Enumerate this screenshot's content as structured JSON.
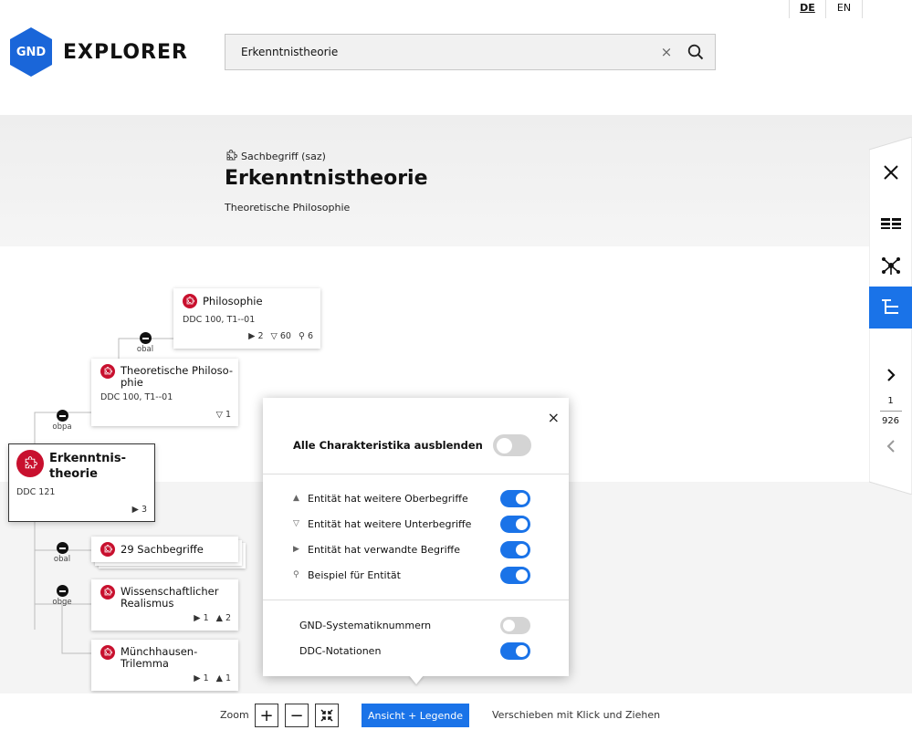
{
  "header": {
    "languages": [
      {
        "label": "DE",
        "active": true
      },
      {
        "label": "EN",
        "active": false
      }
    ],
    "logo_badge": "GND",
    "logo_text": "EXPLORER",
    "search": {
      "value": "Erkenntnistheorie",
      "clear": "×"
    }
  },
  "entity": {
    "type_label": "Sachbegriff (saz)",
    "title": "Erkenntnistheorie",
    "subtitle": "Theoretische Philosophie"
  },
  "rail": {
    "page_current": "1",
    "page_total": "926",
    "buttons": [
      "close-icon",
      "list-icon",
      "network-icon",
      "hierarchy-icon",
      "chevron-right-icon",
      "chevron-left-icon"
    ]
  },
  "tree": {
    "focus": {
      "title": "Erkenntnis-\ntheorie",
      "ddc": "DDC 121",
      "stat_related": "3"
    },
    "nodes": {
      "philosophie": {
        "title": "Philosophie",
        "ddc": "DDC 100, T1--01",
        "stat_related": "2",
        "stat_narrower": "60",
        "stat_example": "6"
      },
      "theoretische": {
        "title": "Theoretische Philoso-\nphie",
        "ddc": "DDC 100, T1--01",
        "stat_narrower": "1"
      },
      "sachbegriffe": {
        "title": "29 Sachbegriffe"
      },
      "realismus": {
        "title": "Wissenschaftlicher\nRealismus",
        "stat_related": "1",
        "stat_broader": "2"
      },
      "muenchhausen": {
        "title": "Münchhausen-\nTrilemma",
        "stat_related": "1",
        "stat_broader": "1"
      }
    },
    "edge_labels": {
      "obal_top": "obal",
      "obpa": "obpa",
      "obal_bottom": "obal",
      "obge": "obge"
    }
  },
  "popup": {
    "close": "×",
    "hide_all_label": "Alle Charakteristika ausblenden",
    "hide_all_on": false,
    "options": [
      {
        "marker": "▲",
        "label": "Entität hat weitere Oberbegriffe",
        "on": true
      },
      {
        "marker": "▽",
        "label": "Entität hat weitere Unterbegriffe",
        "on": true
      },
      {
        "marker": "▶",
        "label": "Entität hat verwandte Begriffe",
        "on": true
      },
      {
        "marker": "⚲",
        "label": "Beispiel für Entität",
        "on": true
      }
    ],
    "numbering": [
      {
        "label": "GND-Systematiknummern",
        "on": false
      },
      {
        "label": "DDC-Notationen",
        "on": true
      }
    ]
  },
  "bottombar": {
    "zoom_label": "Zoom",
    "zoom_in": "+",
    "zoom_out": "−",
    "legend_button": "Ansicht + Legende",
    "pan_hint": "Verschieben mit Klick und Ziehen"
  },
  "colors": {
    "accent": "#1a73e8",
    "gnd_blue": "#1a66d9",
    "node_red": "#c8102e"
  }
}
